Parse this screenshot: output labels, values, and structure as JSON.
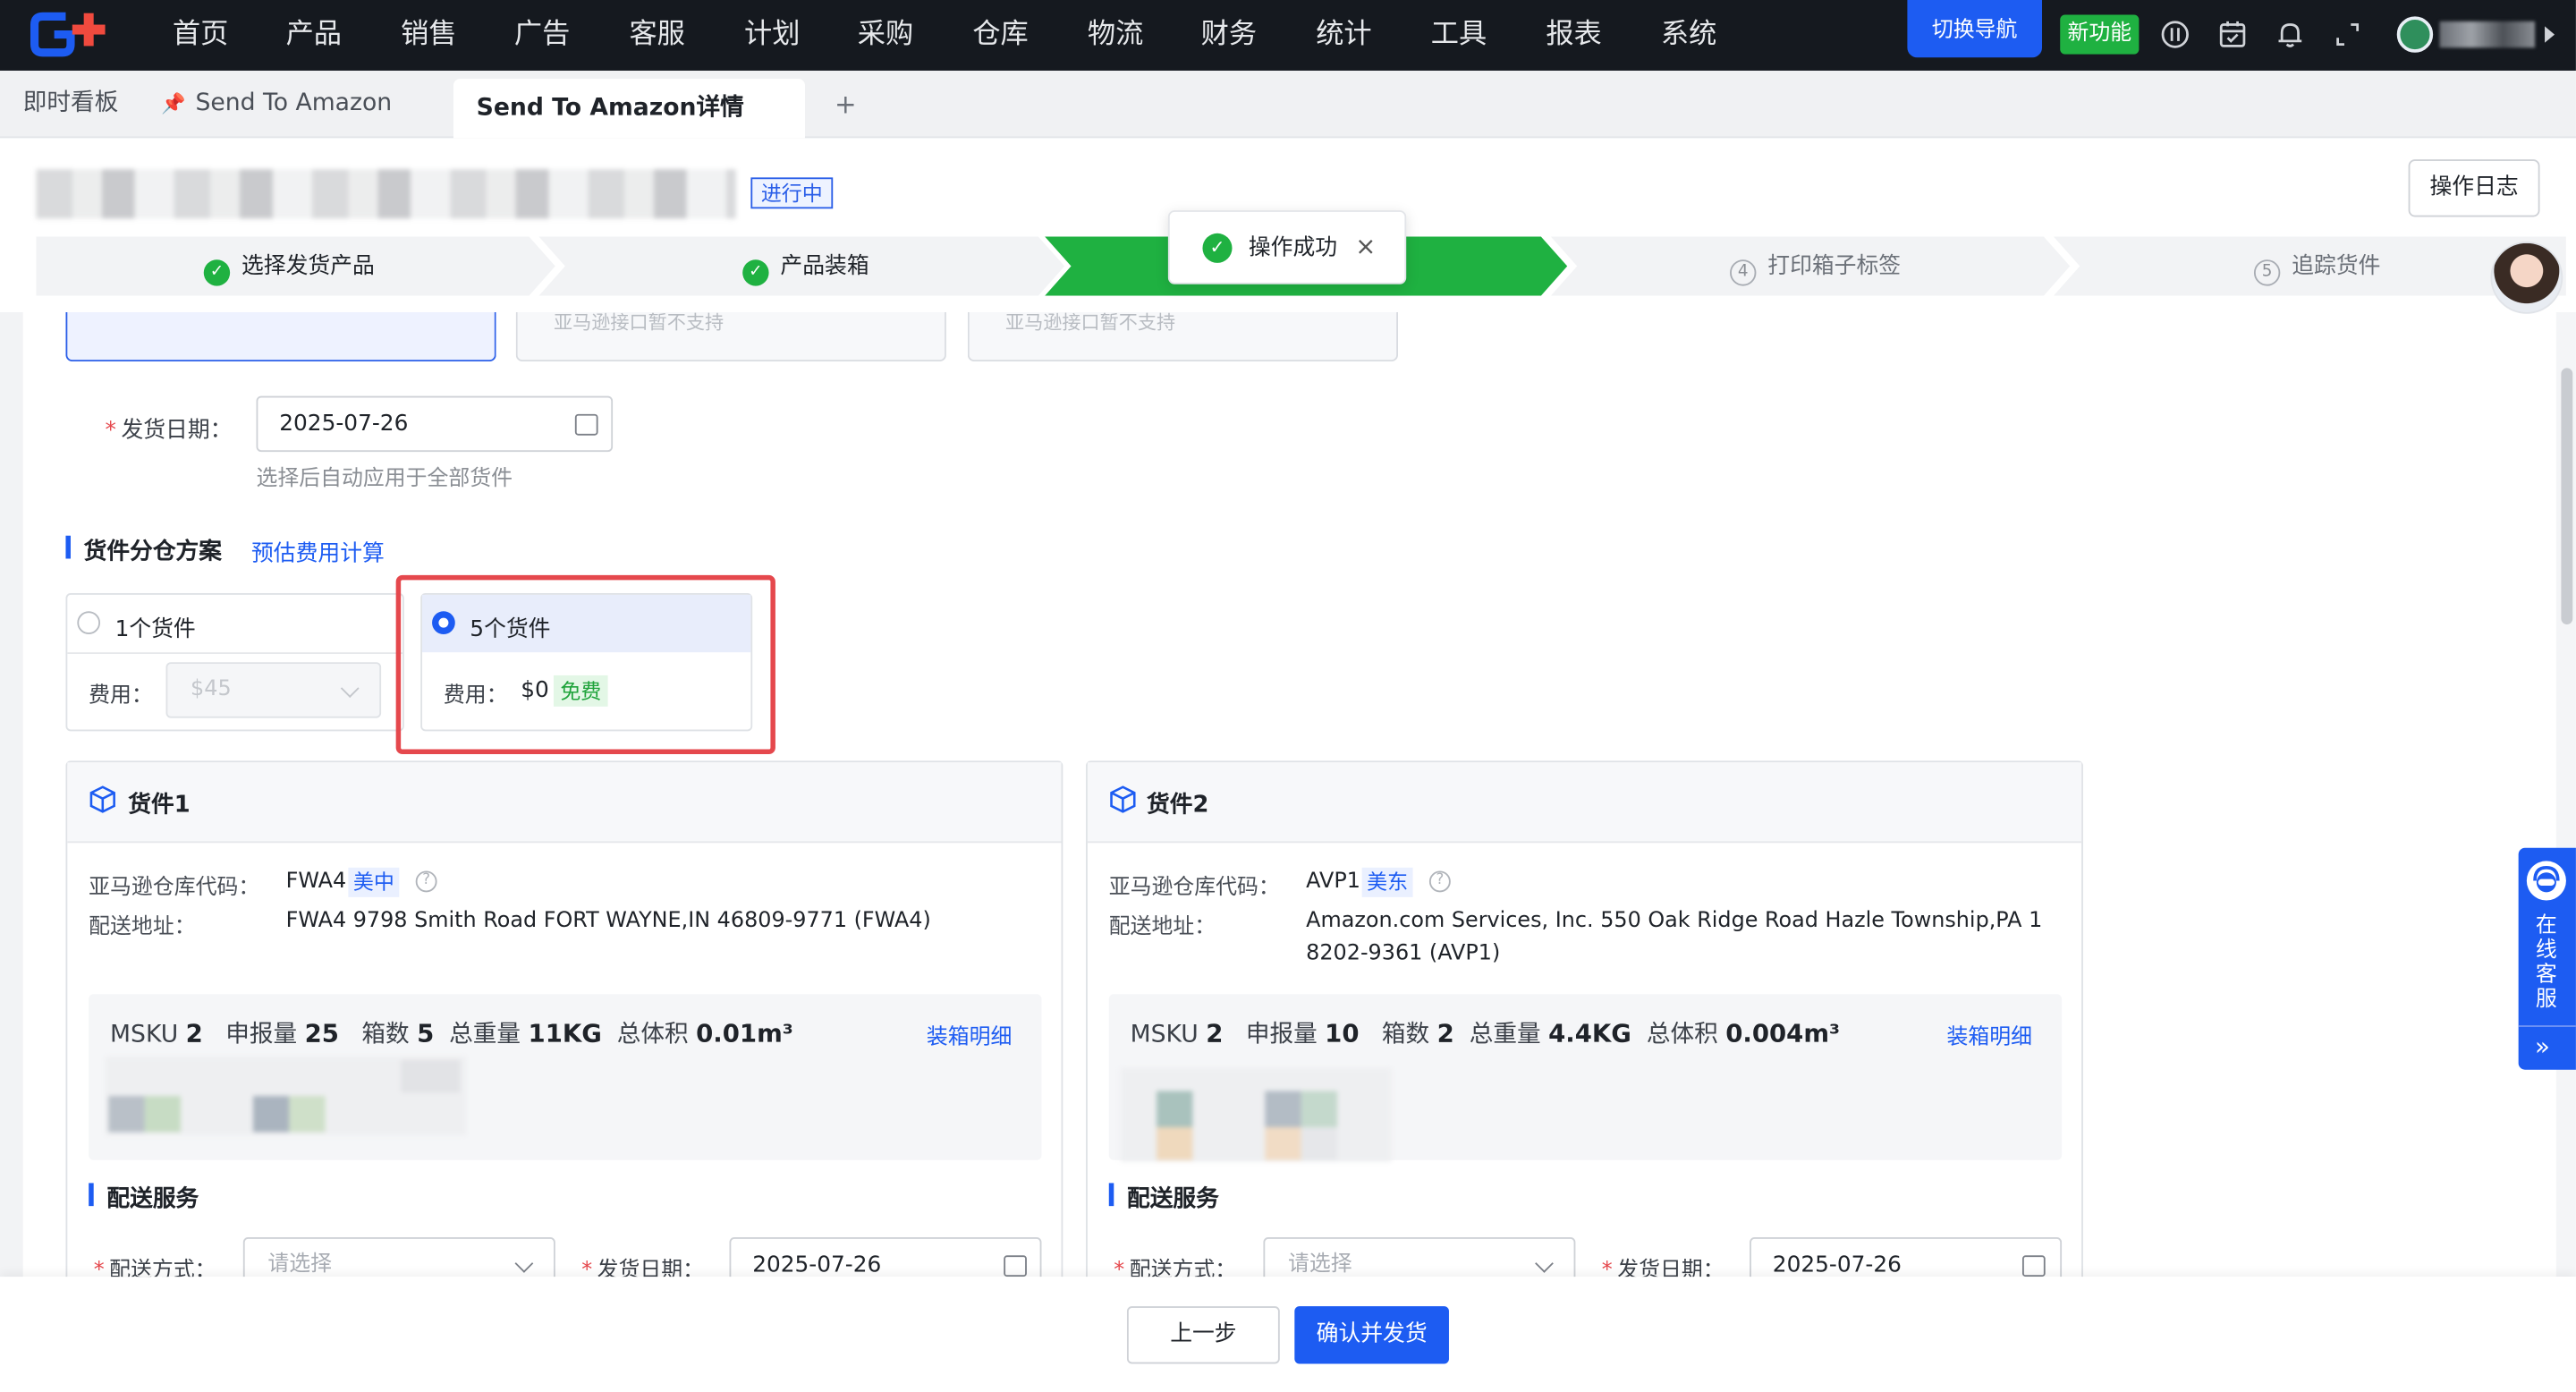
{
  "nav": {
    "items": [
      "首页",
      "产品",
      "销售",
      "广告",
      "客服",
      "计划",
      "采购",
      "仓库",
      "物流",
      "财务",
      "统计",
      "工具",
      "报表",
      "系统"
    ],
    "switch_label": "切换导航",
    "new_feature_label": "新功能"
  },
  "tabs": {
    "dashboard": "即时看板",
    "send": "Send To Amazon",
    "detail": "Send To Amazon详情",
    "add": "+"
  },
  "header": {
    "status": "进行中",
    "log_button": "操作日志"
  },
  "steps": [
    {
      "label": "选择发货产品",
      "state": "done"
    },
    {
      "label": "产品装箱",
      "state": "done"
    },
    {
      "label": "",
      "state": "active"
    },
    {
      "label": "打印箱子标签",
      "state": "todo",
      "number": "4"
    },
    {
      "label": "追踪货件",
      "state": "todo",
      "number": "5"
    }
  ],
  "toast": {
    "text": "操作成功",
    "close": "×"
  },
  "top_cards": {
    "card2_text": "亚马逊接口暂不支持",
    "card3_text": "亚马逊接口暂不支持"
  },
  "ship_date": {
    "label": "发货日期：",
    "value": "2025-07-26",
    "hint": "选择后自动应用于全部货件"
  },
  "plan": {
    "title": "货件分仓方案",
    "estimate_link": "预估费用计算",
    "options": [
      {
        "label": "1个货件",
        "fee_label": "费用：",
        "fee_value": "$45",
        "selected": false
      },
      {
        "label": "5个货件",
        "fee_label": "费用：",
        "fee_value": "$0",
        "free_tag": "免费",
        "selected": true
      }
    ]
  },
  "shipments": [
    {
      "title": "货件1",
      "warehouse_label": "亚马逊仓库代码：",
      "warehouse_code": "FWA4",
      "region": "美中",
      "address_label": "配送地址：",
      "address": "FWA4 9798 Smith Road FORT WAYNE,IN 46809-9771 (FWA4)",
      "address_line2": "",
      "msku_label": "MSKU",
      "msku": "2",
      "declared_label": "申报量",
      "declared": "25",
      "boxes_label": "箱数",
      "boxes": "5",
      "weight_label": "总重量",
      "weight": "11KG",
      "volume_label": "总体积",
      "volume": "0.01m³",
      "detail_link": "装箱明细",
      "delivery_title": "配送服务",
      "method_label": "配送方式：",
      "method_placeholder": "请选择",
      "date_label": "发货日期：",
      "date_value": "2025-07-26"
    },
    {
      "title": "货件2",
      "warehouse_label": "亚马逊仓库代码：",
      "warehouse_code": "AVP1",
      "region": "美东",
      "address_label": "配送地址：",
      "address": "Amazon.com Services, Inc. 550 Oak Ridge Road Hazle Township,PA 1",
      "address_line2": "8202-9361 (AVP1)",
      "msku_label": "MSKU",
      "msku": "2",
      "declared_label": "申报量",
      "declared": "10",
      "boxes_label": "箱数",
      "boxes": "2",
      "weight_label": "总重量",
      "weight": "4.4KG",
      "volume_label": "总体积",
      "volume": "0.004m³",
      "detail_link": "装箱明细",
      "delivery_title": "配送服务",
      "method_label": "配送方式：",
      "method_placeholder": "请选择",
      "date_label": "发货日期：",
      "date_value": "2025-07-26"
    }
  ],
  "footer": {
    "prev": "上一步",
    "confirm": "确认并发货"
  },
  "service": {
    "label": "在线客服",
    "collapse": "»"
  },
  "colors": {
    "accent": "#1d5cf2",
    "success": "#1fb141",
    "danger": "#e5484d",
    "nav_bg": "#15191f"
  }
}
